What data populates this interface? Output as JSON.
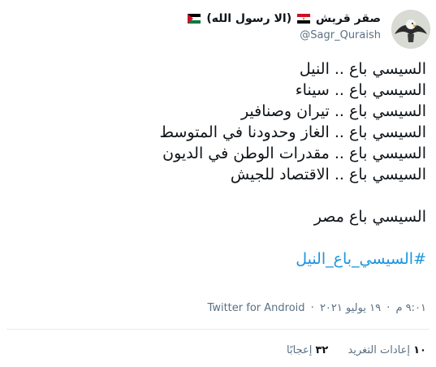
{
  "author": {
    "name": "صقر قريش",
    "name_suffix": "(الا رسول الله)",
    "handle": "@Sagr_Quraish",
    "flags": [
      "egypt-flag-icon",
      "palestine-flag-icon"
    ]
  },
  "tweet": {
    "lines": [
      "السيسي باع .. النيل",
      "السيسي باع .. سيناء",
      "السيسي باع .. تيران وصنافير",
      "السيسي باع .. الغاز وحدودنا في المتوسط",
      "السيسي باع .. مقدرات الوطن في الديون",
      "السيسي باع .. الاقتصاد للجيش"
    ],
    "closing": "السيسي باع مصر",
    "hashtag": "#السيسي_باع_النيل"
  },
  "meta": {
    "time": "٩:٠١ م",
    "date": "١٩ يوليو ٢٠٢١",
    "source": "Twitter for Android"
  },
  "stats": {
    "retweets_count": "١٠",
    "retweets_label": "إعادات التغريد",
    "likes_count": "٣٢",
    "likes_label": "إعجابًا"
  },
  "colors": {
    "link": "#1b95e0",
    "secondary_text": "#5b7083",
    "primary_text": "#0f1419"
  }
}
